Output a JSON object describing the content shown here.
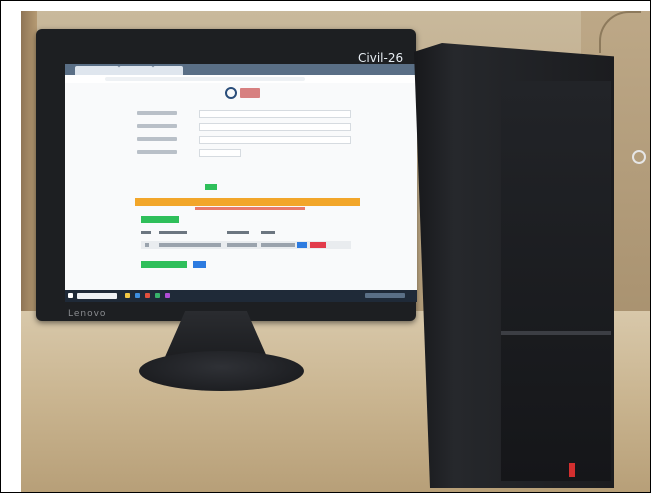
{
  "photo": {
    "monitor_sticker": "Civil-26",
    "monitor_brand": "Lenovo"
  },
  "colors": {
    "banner": "#f2a62a",
    "button_green": "#2fbf5a",
    "button_blue": "#2d7be0",
    "button_red": "#e23b4b",
    "taskbar": "#1f2a38"
  },
  "icons": {
    "power": "power-icon"
  }
}
